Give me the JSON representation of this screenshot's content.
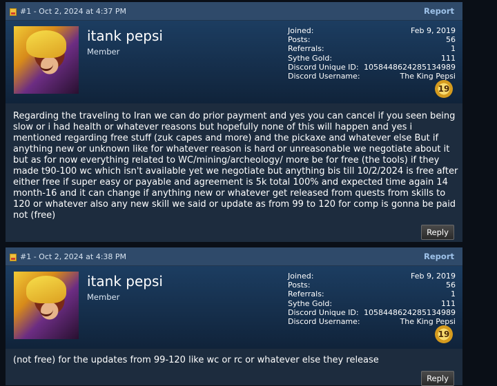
{
  "posts": [
    {
      "meta": "#1 - Oct 2, 2024 at 4:37 PM",
      "report_label": "Report",
      "username": "itank pepsi",
      "role": "Member",
      "info": {
        "joined_label": "Joined:",
        "joined_value": "Feb 9, 2019",
        "posts_label": "Posts:",
        "posts_value": "56",
        "referrals_label": "Referrals:",
        "referrals_value": "1",
        "gold_label": "Sythe Gold:",
        "gold_value": "111",
        "discord_id_label": "Discord Unique ID:",
        "discord_id_value": "1058448624285134989",
        "discord_user_label": "Discord Username:",
        "discord_user_value": "The King Pepsi"
      },
      "badge": "19",
      "body": "Regarding the traveling to Iran we can do prior payment and yes you can cancel if you seen being slow or i had health or whatever reasons but hopefully none of this will happen and yes i mentioned regarding free stuff (zuk capes and more) and the pickaxe and whatever else But if anything new or unknown like for whatever reason is hard or unreasonable we negotiate about it but as for now everything related to WC/mining/archeology/ more be for free (the tools) if they made t90-100 wc which isn't available yet we negotiate but anything bis till 10/2/2024 is free after either free if super easy or payable and agreement is 5k total 100% and expected time again 14 month-16 and it can change if anything new or whatever get released from quests from skills to 120 or whatever also any new skill we said or update as from 99 to 120 for comp is gonna be paid not (free)",
      "reply_label": "Reply"
    },
    {
      "meta": "#1 - Oct 2, 2024 at 4:38 PM",
      "report_label": "Report",
      "username": "itank pepsi",
      "role": "Member",
      "info": {
        "joined_label": "Joined:",
        "joined_value": "Feb 9, 2019",
        "posts_label": "Posts:",
        "posts_value": "56",
        "referrals_label": "Referrals:",
        "referrals_value": "1",
        "gold_label": "Sythe Gold:",
        "gold_value": "111",
        "discord_id_label": "Discord Unique ID:",
        "discord_id_value": "1058448624285134989",
        "discord_user_label": "Discord Username:",
        "discord_user_value": "The King Pepsi"
      },
      "badge": "19",
      "body": "(not free) for the updates from 99-120 like wc or rc or whatever else they release",
      "reply_label": "Reply"
    }
  ]
}
